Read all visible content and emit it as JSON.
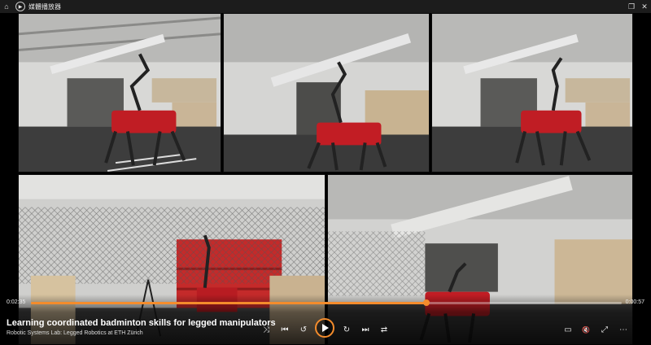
{
  "window": {
    "title": "媒體播放器",
    "buttons": {
      "home": "⌂",
      "restore": "❐",
      "close": "✕"
    }
  },
  "player": {
    "current_time": "0:02:35",
    "duration": "0:00:57",
    "progress": 0.67,
    "video_title": "Learning coordinated badminton skills for legged manipulators",
    "video_subtitle": "Robotic Systems Lab: Legged Robotics at ETH Zürich",
    "icons": {
      "shuffle": "⤨",
      "previous": "⏮",
      "rewind": "↺",
      "forward": "↻",
      "next": "⏭",
      "repeat": "⇄",
      "miniplayer": "▭",
      "mute": "🔇",
      "fullscreen": "⤢",
      "more": "⋯"
    },
    "accent_color": "#f48c2c"
  }
}
